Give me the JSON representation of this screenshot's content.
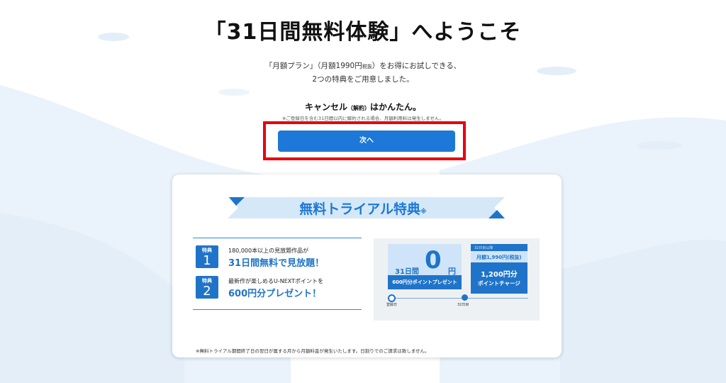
{
  "page": {
    "title": "「31日間無料体験」へようこそ",
    "intro_line1_a": "「月額プラン」（月額1990円",
    "intro_line1_tax": "税抜",
    "intro_line1_b": "）をお得にお試しできる、",
    "intro_line2": "2つの特典をご用意しました。",
    "cancel_a": "キャンセル",
    "cancel_paren": "（解約）",
    "cancel_b": "はかんたん。",
    "cancel_note": "※ご登録日を含む31日間以内に解約される場合、月額利用料は発生しません。",
    "next_button": "次へ"
  },
  "card": {
    "ribbon_title": "無料トライアル特典",
    "ribbon_mark": "※",
    "benefit1": {
      "badge_label": "特典",
      "badge_num": "1",
      "line1": "180,000本以上の見放題作品が",
      "line2": "31日間無料で見放題！"
    },
    "benefit2": {
      "badge_label": "特典",
      "badge_num": "2",
      "line1": "最新作が楽しめるU-NEXTポイントを",
      "line2": "600円分プレゼント！"
    },
    "diagram": {
      "period_label": "31日間",
      "zero": "0",
      "yen": "円",
      "present_points": "600円分ポイントプレゼント",
      "small_top": "32日目以降",
      "monthly_fee": "月額1,990円(税抜)",
      "points_amount": "1,200円分",
      "points_charge": "ポイントチャージ",
      "timeline_start": "登録日",
      "timeline_day32": "32日目"
    },
    "footnote": "※無料トライアル期間終了日の翌日が属する月から月額料金が発生いたします。日割りでのご請求は致しません。"
  },
  "colors": {
    "accent": "#1e78d7",
    "highlight": "#e60012",
    "light_blue": "#cfe4f8"
  }
}
